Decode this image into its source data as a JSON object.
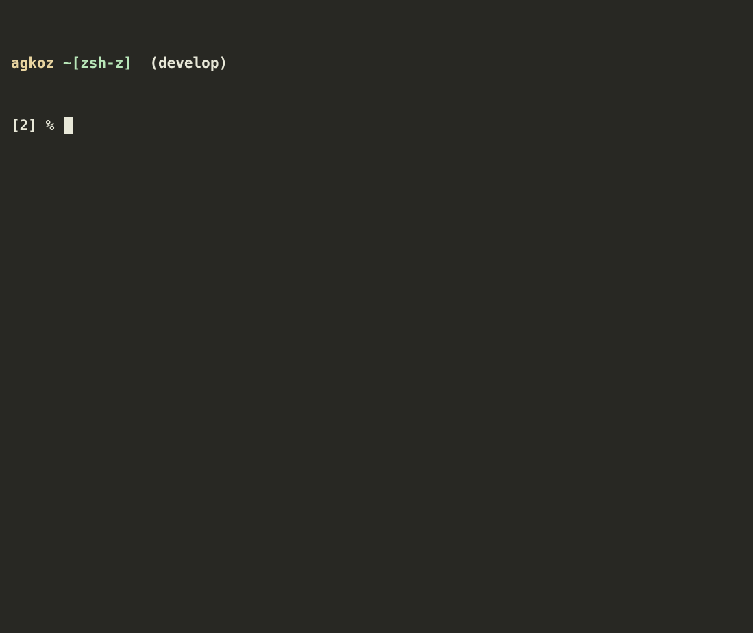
{
  "prompt": {
    "username": "agkoz",
    "path": "~[zsh-z]",
    "branch": "(develop)",
    "line2_prefix": "[2]",
    "symbol": "%"
  }
}
